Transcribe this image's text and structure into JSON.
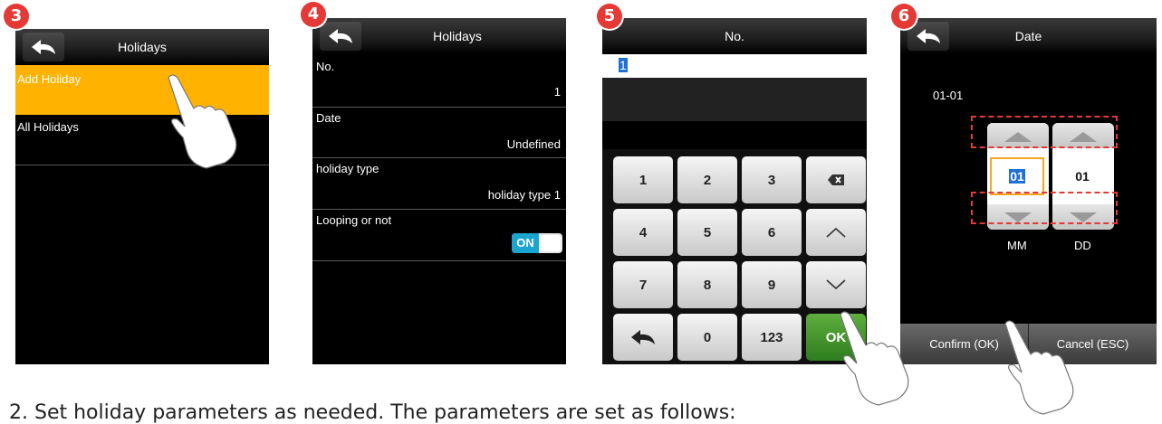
{
  "steps": [
    "3",
    "4",
    "5",
    "6"
  ],
  "panel1": {
    "title": "Holidays",
    "items": [
      {
        "label": "Add Holiday"
      },
      {
        "label": "All Holidays"
      }
    ]
  },
  "panel2": {
    "title": "Holidays",
    "fields": [
      {
        "label": "No.",
        "value": "1"
      },
      {
        "label": "Date",
        "value": "Undefined"
      },
      {
        "label": "holiday type",
        "value": "holiday type 1"
      },
      {
        "label": "Looping or not",
        "value": ""
      }
    ],
    "toggle_label": "ON"
  },
  "panel3": {
    "title": "No.",
    "input_value": "1",
    "keys": [
      "1",
      "2",
      "3",
      "7",
      "5",
      "6",
      "8",
      "9",
      "0",
      "123",
      "OK"
    ],
    "keypad": {
      "r1": [
        "1",
        "2",
        "3"
      ],
      "r2": [
        "4",
        "5",
        "6"
      ],
      "r3": [
        "7",
        "8",
        "9"
      ],
      "r4_mid": "0",
      "r4_right": "123",
      "ok": "OK"
    }
  },
  "panel4": {
    "title": "Date",
    "current": "01-01",
    "month_value": "01",
    "day_value": "01",
    "month_label": "MM",
    "day_label": "DD",
    "confirm_label": "Confirm (OK)",
    "cancel_label": "Cancel (ESC)"
  },
  "caption": "2. Set holiday parameters as needed. The parameters are set as follows:",
  "colors": {
    "highlight": "#ffb300",
    "ok_green": "#3a8b2a",
    "badge": "#e53935",
    "selection": "#1f6fd6"
  }
}
